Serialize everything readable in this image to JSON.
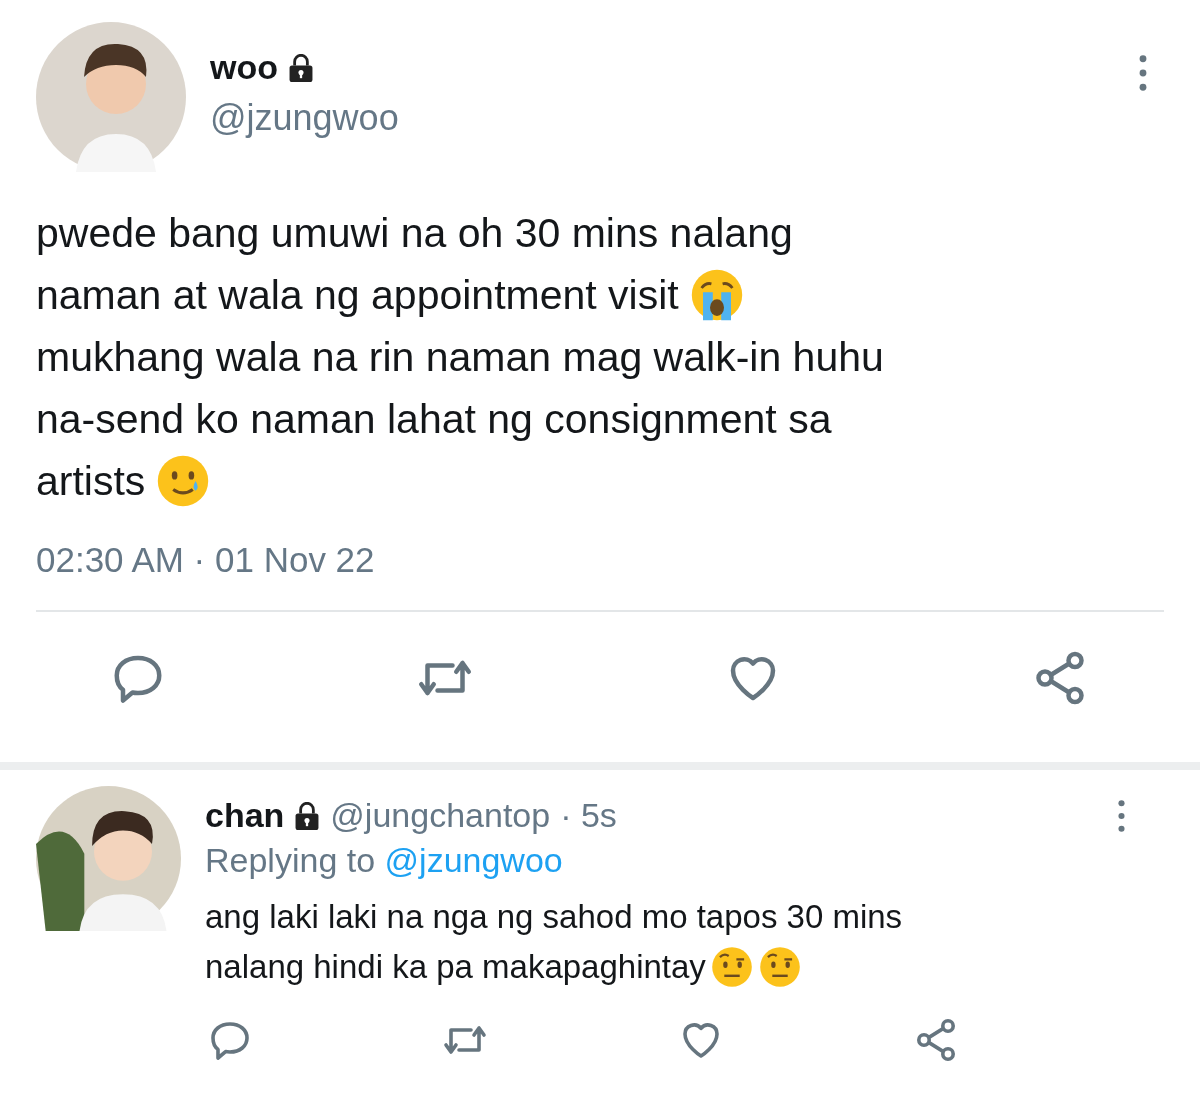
{
  "tweet": {
    "name": "woo",
    "protected": true,
    "handle": "@jzungwoo",
    "lines": [
      [
        {
          "kind": "text",
          "text": "pwede bang umuwi na oh 30 mins nalang"
        }
      ],
      [
        {
          "kind": "text",
          "text": "naman at wala ng appointment visit"
        },
        {
          "kind": "crying"
        }
      ],
      [
        {
          "kind": "text",
          "text": "mukhang wala na rin naman mag walk-in huhu"
        }
      ],
      [
        {
          "kind": "text",
          "text": "na-send ko naman lahat ng consignment sa"
        }
      ],
      [
        {
          "kind": "text",
          "text": "artists"
        },
        {
          "kind": "smiling-tear"
        }
      ]
    ],
    "timestamp": "02:30 AM · 01 Nov 22"
  },
  "reply": {
    "name": "chan",
    "protected": true,
    "handle": "@jungchantop",
    "time": "· 5s",
    "replying_label": "Replying to",
    "replying_to": "@jzungwoo",
    "lines": [
      [
        {
          "kind": "text",
          "text": "ang laki laki na nga ng sahod mo tapos 30 mins"
        }
      ],
      [
        {
          "kind": "text",
          "text": "nalang hindi ka pa makapaghintay"
        },
        {
          "kind": "raised-eyebrow"
        },
        {
          "kind": "raised-eyebrow"
        }
      ]
    ]
  }
}
